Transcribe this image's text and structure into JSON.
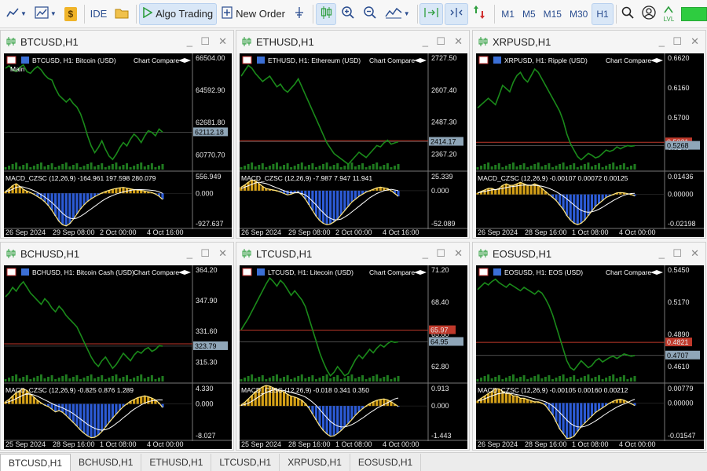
{
  "toolbar": {
    "ide_label": "IDE",
    "algo_label": "Algo Trading",
    "new_order_label": "New Order",
    "timeframes": [
      "M1",
      "M5",
      "M15",
      "M30",
      "H1"
    ],
    "active_timeframe": "H1",
    "lvl_label": "LVL"
  },
  "windows": [
    {
      "title": "BTCUSD,H1",
      "legend_symbol": "BTCUSD,",
      "legend_tf": "H1:",
      "legend_name": "Bitcoin (USD)",
      "compare_label": "Chart Compare",
      "extra_label": "Main",
      "price_ticks": [
        "66504.00",
        "64592.90",
        "62681.80",
        "60770.70"
      ],
      "price_range": [
        59900,
        66504
      ],
      "current_price_label": "62112.18",
      "current_price": 62112.18,
      "ask_line_price": null,
      "price_series": [
        65900,
        66050,
        65800,
        65700,
        65950,
        66100,
        65700,
        65600,
        65850,
        66000,
        65800,
        65500,
        65300,
        65200,
        64700,
        64300,
        64100,
        63900,
        64100,
        63800,
        63600,
        63200,
        62600,
        61900,
        61300,
        60900,
        61200,
        61600,
        61100,
        60700,
        60500,
        60800,
        61200,
        61500,
        61300,
        61700,
        62000,
        61800,
        61500,
        61900,
        62200,
        62100,
        61900,
        62300,
        62112
      ],
      "macd_label": "MACD_CZSC (12,26,9) -164.961 197.598 280.079",
      "macd_ticks": [
        "556.949",
        "0.000",
        "-927.637"
      ],
      "macd_range": [
        -927.637,
        556.949
      ],
      "macd_series": [
        50,
        120,
        210,
        260,
        190,
        110,
        60,
        20,
        -30,
        -90,
        -150,
        -230,
        -330,
        -460,
        -610,
        -760,
        -850,
        -880,
        -820,
        -700,
        -560,
        -420,
        -310,
        -220,
        -150,
        -90,
        -40,
        10,
        50,
        80,
        110,
        130,
        150,
        160,
        140,
        120,
        100,
        90,
        80,
        60,
        40,
        20,
        -20,
        -80,
        -165
      ],
      "signal_series": [
        40,
        70,
        110,
        160,
        180,
        170,
        140,
        110,
        70,
        20,
        -40,
        -100,
        -170,
        -250,
        -340,
        -440,
        -540,
        -620,
        -670,
        -690,
        -670,
        -620,
        -560,
        -490,
        -420,
        -350,
        -280,
        -210,
        -150,
        -100,
        -60,
        -20,
        10,
        40,
        60,
        80,
        95,
        100,
        100,
        95,
        90,
        80,
        70,
        40,
        0
      ],
      "date_labels": [
        "26 Sep 2024",
        "29 Sep 08:00",
        "2 Oct 00:00",
        "4 Oct 16:00"
      ]
    },
    {
      "title": "ETHUSD,H1",
      "legend_symbol": "ETHUSD,",
      "legend_tf": "H1:",
      "legend_name": "Ethereum (USD)",
      "compare_label": "Chart Compare",
      "extra_label": "",
      "price_ticks": [
        "2727.50",
        "2607.40",
        "2487.30",
        "2367.20"
      ],
      "price_range": [
        2310,
        2727.5
      ],
      "current_price_label": "2414.17",
      "current_price": 2414.17,
      "ask_line_price": 2418,
      "price_series": [
        2660,
        2680,
        2700,
        2690,
        2670,
        2655,
        2640,
        2650,
        2660,
        2640,
        2620,
        2630,
        2610,
        2600,
        2615,
        2630,
        2650,
        2620,
        2590,
        2560,
        2530,
        2500,
        2470,
        2440,
        2410,
        2390,
        2370,
        2360,
        2350,
        2340,
        2330,
        2345,
        2360,
        2375,
        2365,
        2355,
        2370,
        2385,
        2400,
        2395,
        2410,
        2420,
        2405,
        2410,
        2414
      ],
      "macd_label": "MACD_CZSC (12,26,9) -7.987 7.947 11.941",
      "macd_ticks": [
        "25.339",
        "0.000",
        "-52.089"
      ],
      "macd_range": [
        -52.089,
        25.339
      ],
      "macd_series": [
        5,
        8,
        12,
        15,
        14,
        10,
        6,
        3,
        2,
        1,
        0,
        -2,
        -4,
        -6,
        -5,
        -3,
        -2,
        -6,
        -12,
        -20,
        -28,
        -36,
        -42,
        -46,
        -48,
        -47,
        -44,
        -40,
        -34,
        -28,
        -22,
        -16,
        -12,
        -8,
        -5,
        -2,
        0,
        2,
        4,
        5,
        4,
        3,
        0,
        -4,
        -8
      ],
      "signal_series": [
        3,
        5,
        7,
        9,
        11,
        12,
        11,
        10,
        8,
        6,
        4,
        2,
        0,
        -2,
        -3,
        -3,
        -3,
        -4,
        -6,
        -10,
        -15,
        -20,
        -26,
        -31,
        -36,
        -39,
        -41,
        -41,
        -40,
        -37,
        -34,
        -30,
        -26,
        -22,
        -18,
        -14,
        -10,
        -7,
        -4,
        -2,
        0,
        1,
        2,
        1,
        0
      ],
      "date_labels": [
        "26 Sep 2024",
        "29 Sep 08:00",
        "2 Oct 00:00",
        "4 Oct 16:00"
      ]
    },
    {
      "title": "XRPUSD,H1",
      "legend_symbol": "XRPUSD,",
      "legend_tf": "H1:",
      "legend_name": "Ripple (USD)",
      "compare_label": "Chart Compare",
      "extra_label": "",
      "price_ticks": [
        "0.6620",
        "0.6160",
        "0.5700",
        "0.5240"
      ],
      "price_range": [
        0.49,
        0.662
      ],
      "current_price_label": "0.5268",
      "current_price": 0.5268,
      "ask_line_price": 0.5321,
      "ask_line_label": "0.5321",
      "price_series": [
        0.585,
        0.59,
        0.595,
        0.6,
        0.595,
        0.59,
        0.605,
        0.62,
        0.615,
        0.61,
        0.625,
        0.635,
        0.64,
        0.63,
        0.625,
        0.635,
        0.645,
        0.64,
        0.63,
        0.62,
        0.61,
        0.6,
        0.59,
        0.58,
        0.565,
        0.545,
        0.53,
        0.52,
        0.51,
        0.505,
        0.51,
        0.515,
        0.512,
        0.508,
        0.51,
        0.515,
        0.52,
        0.518,
        0.52,
        0.525,
        0.522,
        0.525,
        0.527,
        0.526,
        0.5268
      ],
      "macd_label": "MACD_CZSC (12,26,9) -0.00107 0.00072 0.00125",
      "macd_ticks": [
        "0.01436",
        "0.00000",
        "-0.02198"
      ],
      "macd_range": [
        -0.02198,
        0.01436
      ],
      "macd_series": [
        0.001,
        0.002,
        0.003,
        0.004,
        0.004,
        0.003,
        0.004,
        0.006,
        0.007,
        0.006,
        0.006,
        0.007,
        0.008,
        0.007,
        0.006,
        0.006,
        0.007,
        0.006,
        0.004,
        0.002,
        0.0,
        -0.002,
        -0.004,
        -0.007,
        -0.01,
        -0.014,
        -0.017,
        -0.019,
        -0.02,
        -0.019,
        -0.017,
        -0.014,
        -0.011,
        -0.008,
        -0.006,
        -0.004,
        -0.002,
        -0.001,
        0.0,
        0.001,
        0.0012,
        0.001,
        0.0005,
        0.0,
        -0.00107
      ],
      "signal_series": [
        0.001,
        0.0015,
        0.002,
        0.0025,
        0.003,
        0.0032,
        0.0035,
        0.004,
        0.0045,
        0.005,
        0.0053,
        0.0056,
        0.006,
        0.0062,
        0.0062,
        0.0061,
        0.006,
        0.0058,
        0.0054,
        0.0048,
        0.004,
        0.003,
        0.0018,
        0.0004,
        -0.0012,
        -0.003,
        -0.005,
        -0.007,
        -0.009,
        -0.0105,
        -0.0115,
        -0.0118,
        -0.0115,
        -0.0108,
        -0.0098,
        -0.0085,
        -0.007,
        -0.0055,
        -0.004,
        -0.0028,
        -0.0016,
        -0.0006,
        0.0002,
        0.0006,
        0.00072
      ],
      "date_labels": [
        "26 Sep 2024",
        "28 Sep 16:00",
        "1 Oct 08:00",
        "4 Oct 00:00"
      ]
    },
    {
      "title": "BCHUSD,H1",
      "legend_symbol": "BCHUSD,",
      "legend_tf": "H1:",
      "legend_name": "Bitcoin Cash (USD)",
      "compare_label": "Chart Compare",
      "extra_label": "",
      "price_ticks": [
        "364.20",
        "347.90",
        "331.60",
        "315.30"
      ],
      "price_range": [
        305,
        364.2
      ],
      "current_price_label": "323.79",
      "current_price": 323.79,
      "ask_line_price": 325,
      "price_series": [
        350,
        352,
        355,
        353,
        356,
        358,
        355,
        352,
        350,
        348,
        346,
        349,
        347,
        344,
        342,
        345,
        343,
        340,
        338,
        336,
        334,
        330,
        326,
        322,
        318,
        315,
        313,
        316,
        318,
        315,
        312,
        314,
        317,
        320,
        318,
        316,
        319,
        321,
        320,
        322,
        323,
        321,
        322,
        324,
        323.79
      ],
      "macd_label": "MACD_CZSC (12,26,9) -0.825 0.876 1.289",
      "macd_ticks": [
        "4.330",
        "0.000",
        "-8.027"
      ],
      "macd_range": [
        -8.027,
        4.33
      ],
      "macd_series": [
        0.5,
        1.0,
        1.8,
        2.5,
        3.0,
        3.4,
        3.0,
        2.2,
        1.5,
        0.8,
        0.2,
        -0.3,
        -0.6,
        -1.2,
        -1.8,
        -1.5,
        -1.9,
        -2.6,
        -3.4,
        -4.2,
        -5.0,
        -5.9,
        -6.6,
        -7.2,
        -7.6,
        -7.5,
        -7.0,
        -6.2,
        -5.2,
        -4.2,
        -3.2,
        -2.3,
        -1.4,
        -0.6,
        0.0,
        0.6,
        1.0,
        1.4,
        1.6,
        1.8,
        1.6,
        1.3,
        0.9,
        0.2,
        -0.8
      ],
      "signal_series": [
        0.3,
        0.5,
        0.8,
        1.2,
        1.6,
        2.0,
        2.2,
        2.2,
        2.0,
        1.7,
        1.3,
        0.9,
        0.5,
        0.1,
        -0.3,
        -0.6,
        -0.9,
        -1.3,
        -1.7,
        -2.2,
        -2.8,
        -3.4,
        -4.0,
        -4.6,
        -5.1,
        -5.5,
        -5.8,
        -5.9,
        -5.8,
        -5.5,
        -5.0,
        -4.4,
        -3.8,
        -3.1,
        -2.5,
        -1.8,
        -1.2,
        -0.7,
        -0.2,
        0.2,
        0.5,
        0.7,
        0.8,
        0.9,
        0.88
      ],
      "date_labels": [
        "25 Sep 2024",
        "28 Sep 16:00",
        "1 Oct 08:00",
        "4 Oct 00:00"
      ]
    },
    {
      "title": "LTCUSD,H1",
      "legend_symbol": "LTCUSD,",
      "legend_tf": "H1:",
      "legend_name": "Litecoin (USD)",
      "compare_label": "Chart Compare",
      "extra_label": "",
      "price_ticks": [
        "71.20",
        "68.40",
        "65.60",
        "62.80"
      ],
      "price_range": [
        61.5,
        71.2
      ],
      "current_price_label": "64.95",
      "current_price": 64.95,
      "ask_line_price": 65.97,
      "ask_line_label": "65.97",
      "price_series": [
        66.0,
        66.5,
        67.0,
        67.6,
        68.2,
        68.8,
        69.4,
        70.0,
        70.5,
        70.2,
        69.8,
        70.3,
        70.0,
        69.5,
        69.0,
        69.4,
        69.0,
        68.6,
        68.0,
        67.0,
        66.0,
        65.0,
        64.0,
        63.2,
        62.5,
        62.0,
        62.3,
        62.8,
        62.4,
        62.0,
        62.2,
        62.8,
        63.4,
        63.8,
        63.5,
        63.9,
        64.3,
        64.0,
        64.4,
        64.7,
        64.5,
        64.8,
        65.0,
        64.9,
        64.95
      ],
      "macd_label": "MACD_CZSC (12,26,9) -0.018 0.341 0.350",
      "macd_ticks": [
        "0.913",
        "0.000",
        "-1.443"
      ],
      "macd_range": [
        -1.443,
        0.913
      ],
      "macd_series": [
        0.05,
        0.15,
        0.3,
        0.45,
        0.6,
        0.72,
        0.82,
        0.88,
        0.85,
        0.78,
        0.7,
        0.66,
        0.6,
        0.5,
        0.42,
        0.38,
        0.32,
        0.24,
        0.1,
        -0.1,
        -0.35,
        -0.6,
        -0.85,
        -1.05,
        -1.2,
        -1.3,
        -1.28,
        -1.18,
        -1.05,
        -0.9,
        -0.75,
        -0.58,
        -0.4,
        -0.25,
        -0.12,
        0.0,
        0.1,
        0.18,
        0.24,
        0.28,
        0.3,
        0.26,
        0.18,
        0.08,
        -0.018
      ],
      "signal_series": [
        0.02,
        0.06,
        0.12,
        0.2,
        0.3,
        0.4,
        0.5,
        0.58,
        0.64,
        0.68,
        0.69,
        0.68,
        0.66,
        0.62,
        0.58,
        0.54,
        0.5,
        0.45,
        0.38,
        0.28,
        0.16,
        0.02,
        -0.15,
        -0.33,
        -0.5,
        -0.66,
        -0.78,
        -0.86,
        -0.9,
        -0.9,
        -0.86,
        -0.8,
        -0.72,
        -0.62,
        -0.52,
        -0.41,
        -0.3,
        -0.2,
        -0.1,
        -0.02,
        0.06,
        0.14,
        0.22,
        0.3,
        0.341
      ],
      "date_labels": [
        "25 Sep 2024",
        "28 Sep 16:00",
        "1 Oct 08:00",
        "4 Oct 00:00"
      ]
    },
    {
      "title": "EOSUSD,H1",
      "legend_symbol": "EOSUSD,",
      "legend_tf": "H1:",
      "legend_name": "EOS (USD)",
      "compare_label": "Chart Compare",
      "extra_label": "",
      "price_ticks": [
        "0.5450",
        "0.5170",
        "0.4890",
        "0.4610"
      ],
      "price_range": [
        0.448,
        0.545
      ],
      "current_price_label": "0.4707",
      "current_price": 0.4707,
      "ask_line_price": 0.4821,
      "ask_line_label": "0.4821",
      "price_series": [
        0.528,
        0.531,
        0.534,
        0.532,
        0.535,
        0.537,
        0.534,
        0.532,
        0.53,
        0.533,
        0.531,
        0.529,
        0.527,
        0.53,
        0.528,
        0.526,
        0.524,
        0.527,
        0.525,
        0.52,
        0.514,
        0.506,
        0.496,
        0.486,
        0.476,
        0.466,
        0.46,
        0.458,
        0.462,
        0.466,
        0.463,
        0.46,
        0.462,
        0.466,
        0.468,
        0.465,
        0.467,
        0.469,
        0.47,
        0.468,
        0.47,
        0.472,
        0.471,
        0.47,
        0.4707
      ],
      "macd_label": "MACD_CZSC (12,26,9) -0.00105 0.00160 0.00212",
      "macd_ticks": [
        "0.00779",
        "0.00000",
        "-0.01547"
      ],
      "macd_range": [
        -0.01547,
        0.00779
      ],
      "macd_series": [
        0.001,
        0.002,
        0.003,
        0.004,
        0.005,
        0.006,
        0.006,
        0.005,
        0.004,
        0.004,
        0.003,
        0.003,
        0.002,
        0.002,
        0.0015,
        0.001,
        0.0005,
        0.0005,
        0.0,
        -0.001,
        -0.003,
        -0.005,
        -0.008,
        -0.011,
        -0.013,
        -0.015,
        -0.0148,
        -0.014,
        -0.012,
        -0.01,
        -0.0085,
        -0.007,
        -0.0055,
        -0.004,
        -0.003,
        -0.002,
        -0.001,
        0.0,
        0.0008,
        0.0014,
        0.0016,
        0.0012,
        0.0005,
        -0.0003,
        -0.00105
      ],
      "signal_series": [
        0.0008,
        0.0012,
        0.0018,
        0.0024,
        0.003,
        0.0036,
        0.004,
        0.0042,
        0.0042,
        0.0041,
        0.0039,
        0.0036,
        0.0033,
        0.003,
        0.0026,
        0.0022,
        0.0018,
        0.0014,
        0.001,
        0.0005,
        -0.0002,
        -0.0012,
        -0.0025,
        -0.004,
        -0.0056,
        -0.0072,
        -0.0086,
        -0.0096,
        -0.0101,
        -0.0102,
        -0.0099,
        -0.0093,
        -0.0085,
        -0.0076,
        -0.0066,
        -0.0055,
        -0.0045,
        -0.0035,
        -0.0026,
        -0.0017,
        -0.001,
        -0.0004,
        0.0002,
        0.001,
        0.0016
      ],
      "date_labels": [
        "26 Sep 2024",
        "28 Sep 16:00",
        "1 Oct 08:00",
        "4 Oct 00:00"
      ]
    }
  ],
  "bottom_tabs": [
    "BTCUSD,H1",
    "BCHUSD,H1",
    "ETHUSD,H1",
    "LTCUSD,H1",
    "XRPUSD,H1",
    "EOSUSD,H1"
  ],
  "active_bottom_tab": "BTCUSD,H1",
  "colors": {
    "chart_bg": "#000000",
    "price_line": "#1a8a1a",
    "volume": "#1f7a1f",
    "axis_text": "#e8e8e8",
    "ask_line": "#c0392b",
    "current_price_box": "#8fa6b8",
    "macd_line": "#ffe680",
    "signal_line": "#ffffff",
    "hist_up": "#d4a017",
    "hist_down": "#2c5bd6",
    "lvl_bar": "#2ecc40"
  }
}
